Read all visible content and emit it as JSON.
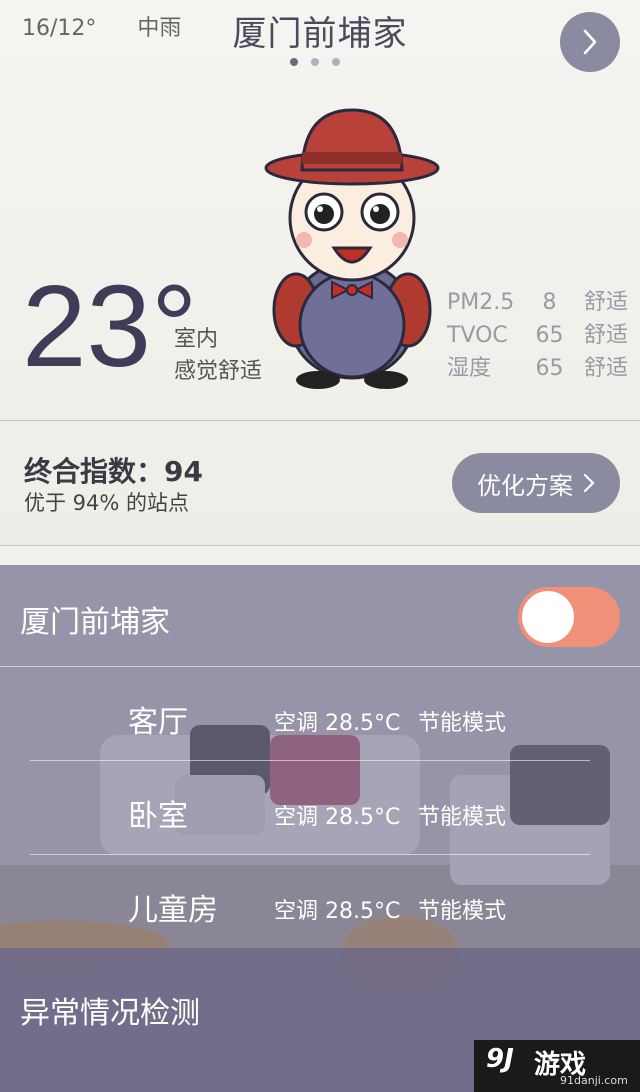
{
  "header": {
    "temp_range": "16/12°",
    "weather": "中雨",
    "title": "厦门前埔家",
    "next_icon": "chevron-right-icon"
  },
  "pager": {
    "total": 3,
    "active": 0
  },
  "indoor": {
    "temperature": "23°",
    "location": "室内",
    "feeling": "感觉舒适"
  },
  "metrics": [
    {
      "name": "PM2.5",
      "value": "8",
      "status": "舒适"
    },
    {
      "name": "TVOC",
      "value": "65",
      "status": "舒适"
    },
    {
      "name": "湿度",
      "value": "65",
      "status": "舒适"
    }
  ],
  "score": {
    "label": "终合指数：94",
    "compare": "优于 94% 的站点",
    "button": "优化方案"
  },
  "home": {
    "name": "厦门前埔家",
    "toggle_on": true,
    "toggle_color": "#f09078"
  },
  "rooms": [
    {
      "name": "客厅",
      "ac": "空调 28.5°C",
      "mode": "节能模式"
    },
    {
      "name": "卧室",
      "ac": "空调 28.5°C",
      "mode": "节能模式"
    },
    {
      "name": "儿童房",
      "ac": "空调 28.5°C",
      "mode": "节能模式"
    }
  ],
  "anomaly": {
    "label": "异常情况检测"
  },
  "watermark": {
    "logo": "9J",
    "text": "游戏",
    "url": "91danji.com"
  },
  "colors": {
    "accent": "#8a8aa0",
    "text_dark": "#3d3d58"
  }
}
